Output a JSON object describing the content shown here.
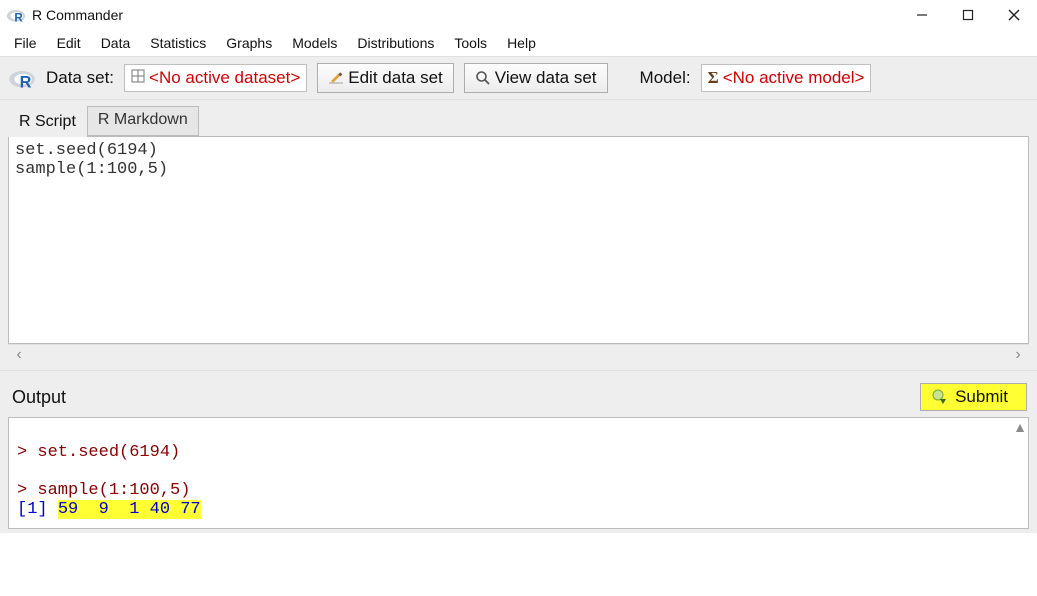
{
  "window": {
    "title": "R Commander"
  },
  "menu": {
    "items": [
      "File",
      "Edit",
      "Data",
      "Statistics",
      "Graphs",
      "Models",
      "Distributions",
      "Tools",
      "Help"
    ]
  },
  "toolbar": {
    "dataset_label": "Data set:",
    "dataset_value": "<No active dataset>",
    "edit_btn": "Edit data set",
    "view_btn": "View data set",
    "model_label": "Model:",
    "model_value": "<No active model>"
  },
  "tabs": {
    "active": "R Script",
    "inactive": "R Markdown"
  },
  "script": {
    "line1": "set.seed(6194)",
    "line2": "sample(1:100,5)"
  },
  "output_section": {
    "label": "Output",
    "submit": "Submit"
  },
  "output": {
    "prompt1": "> set.seed(6194)",
    "blank": "",
    "prompt2": "> sample(1:100,5)",
    "idx": "[1] ",
    "result": "59  9  1 40 77"
  }
}
